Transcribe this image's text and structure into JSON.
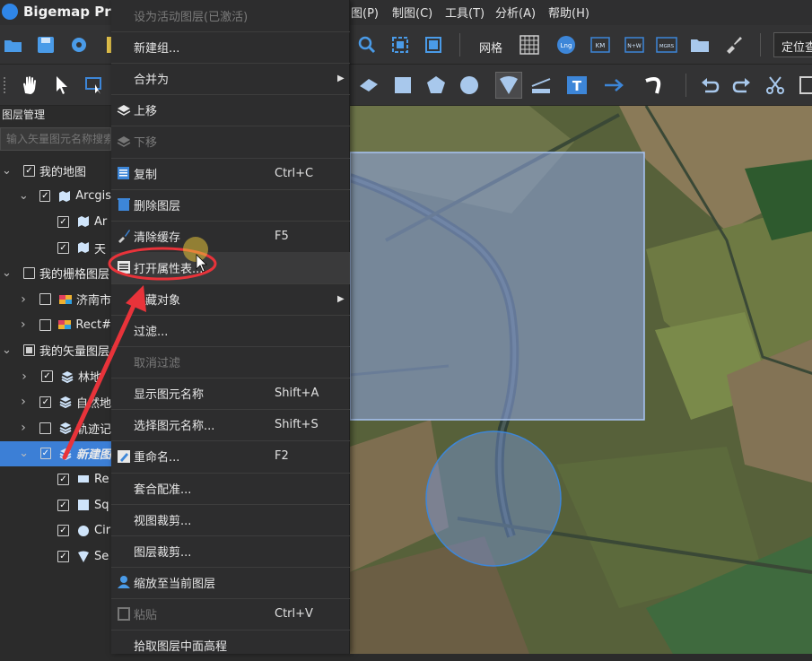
{
  "app": {
    "title": "Bigemap Pro"
  },
  "menubar": [
    {
      "label": "图(P)",
      "underline": "P"
    },
    {
      "label": "制图(C)"
    },
    {
      "label": "工具(T)"
    },
    {
      "label": "分析(A)"
    },
    {
      "label": "帮助(H)"
    }
  ],
  "toolbar1": {
    "grid_label": "网格",
    "locate_label": "定位查"
  },
  "layer_panel": {
    "title": "图层管理",
    "search_placeholder": "输入矢量图元名称搜索",
    "tree": [
      {
        "label": "我的地图",
        "level": 0,
        "expanded": true,
        "checked": true
      },
      {
        "label": "Arcgis",
        "level": 1,
        "expanded": true,
        "checked": true,
        "icon": "map-icon"
      },
      {
        "label": "Ar",
        "level": 2,
        "checked": true,
        "icon": "map-icon"
      },
      {
        "label": "天",
        "level": 2,
        "checked": true,
        "icon": "map-icon"
      },
      {
        "label": "我的栅格图层",
        "level": 0,
        "expanded": true,
        "checked": false
      },
      {
        "label": "济南市",
        "level": 1,
        "expanded": false,
        "checked": false,
        "icon": "raster-icon"
      },
      {
        "label": "Rect#",
        "level": 1,
        "expanded": false,
        "checked": false,
        "icon": "raster-icon"
      },
      {
        "label": "我的矢量图层",
        "level": 0,
        "expanded": true,
        "checked": "partial"
      },
      {
        "label": "林地",
        "level": 1,
        "expanded": false,
        "checked": true,
        "icon": "layers-icon"
      },
      {
        "label": "自然地",
        "level": 1,
        "expanded": false,
        "checked": true,
        "icon": "layers-icon"
      },
      {
        "label": "轨迹记",
        "level": 1,
        "expanded": false,
        "checked": false,
        "icon": "layers-icon"
      },
      {
        "label": "新建图",
        "level": 1,
        "expanded": true,
        "checked": true,
        "icon": "layers-icon",
        "selected": true
      },
      {
        "label": "Re",
        "level": 2,
        "checked": true,
        "icon": "rectangle-icon"
      },
      {
        "label": "Sq",
        "level": 2,
        "checked": true,
        "icon": "square-icon"
      },
      {
        "label": "Cir",
        "level": 2,
        "checked": true,
        "icon": "circle-icon"
      },
      {
        "label": "Se",
        "level": 2,
        "checked": true,
        "icon": "sector-icon"
      }
    ]
  },
  "context_menu": {
    "items": [
      {
        "label": "设为活动图层(已激活)",
        "disabled": true
      },
      {
        "label": "新建组..."
      },
      {
        "label": "合并为",
        "submenu": true
      },
      {
        "label": "上移",
        "icon": "move-up-icon"
      },
      {
        "label": "下移",
        "icon": "move-down-icon",
        "disabled": true
      },
      {
        "label": "复制",
        "icon": "copy-icon",
        "shortcut": "Ctrl+C"
      },
      {
        "label": "删除图层",
        "icon": "delete-icon"
      },
      {
        "label": "清除缓存",
        "icon": "broom-icon",
        "shortcut": "F5"
      },
      {
        "label": "打开属性表...",
        "icon": "table-icon",
        "highlighted": true
      },
      {
        "label": "隐藏对象",
        "submenu": true
      },
      {
        "label": "过滤..."
      },
      {
        "label": "取消过滤",
        "disabled": true
      },
      {
        "label": "显示图元名称",
        "shortcut": "Shift+A"
      },
      {
        "label": "选择图元名称...",
        "shortcut": "Shift+S"
      },
      {
        "label": "重命名...",
        "icon": "rename-icon",
        "shortcut": "F2"
      },
      {
        "label": "套合配准..."
      },
      {
        "label": "视图裁剪..."
      },
      {
        "label": "图层裁剪..."
      },
      {
        "label": "缩放至当前图层",
        "icon": "zoom-layer-icon"
      },
      {
        "label": "粘贴",
        "icon": "paste-icon",
        "shortcut": "Ctrl+V",
        "disabled": true
      },
      {
        "label": "拾取图层中面高程"
      }
    ]
  },
  "colors": {
    "accent": "#3c7fd6",
    "annotation": "#e8333a",
    "menu_bg": "#2d2d2e"
  }
}
